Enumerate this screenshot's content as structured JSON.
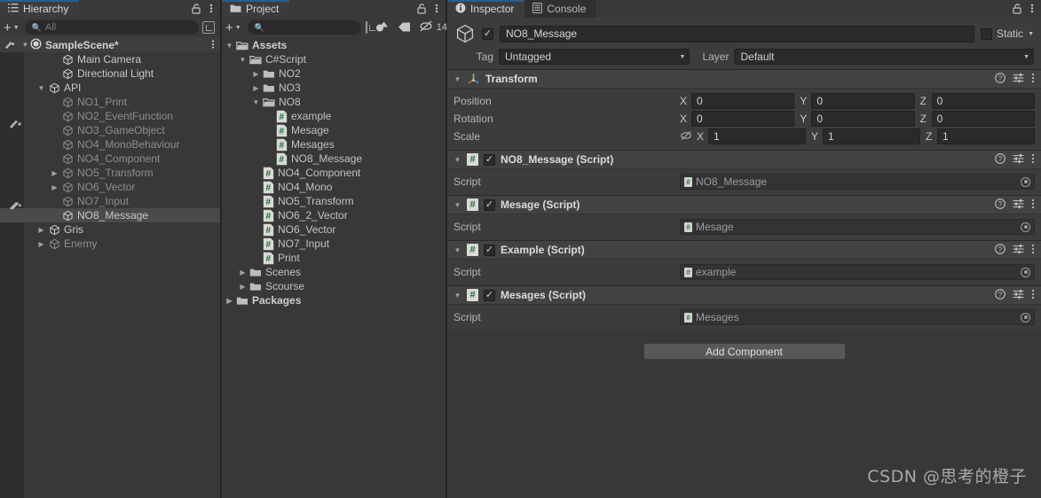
{
  "hierarchy": {
    "tab_label": "Hierarchy",
    "tab_icon": "list-icon",
    "lock_icon": "lock-open-icon",
    "menu_icon": "kebab-menu-icon",
    "add_label": "+",
    "search_placeholder": "All",
    "search_value": "",
    "scene_name": "SampleScene*",
    "items": [
      {
        "label": "Main Camera",
        "depth": 2,
        "arrow": "none",
        "dim": false
      },
      {
        "label": "Directional Light",
        "depth": 2,
        "arrow": "none",
        "dim": false
      },
      {
        "label": "API",
        "depth": 1,
        "arrow": "open",
        "dim": false
      },
      {
        "label": "NO1_Print",
        "depth": 2,
        "arrow": "none",
        "dim": true
      },
      {
        "label": "NO2_EventFunction",
        "depth": 2,
        "arrow": "none",
        "dim": true
      },
      {
        "label": "NO3_GameObject",
        "depth": 2,
        "arrow": "none",
        "dim": true
      },
      {
        "label": "NO4_MonoBehaviour",
        "depth": 2,
        "arrow": "none",
        "dim": true
      },
      {
        "label": "NO4_Component",
        "depth": 2,
        "arrow": "none",
        "dim": true
      },
      {
        "label": "NO5_Transform",
        "depth": 2,
        "arrow": "closed",
        "dim": true
      },
      {
        "label": "NO6_Vector",
        "depth": 2,
        "arrow": "closed",
        "dim": true
      },
      {
        "label": "NO7_Input",
        "depth": 2,
        "arrow": "none",
        "dim": true
      },
      {
        "label": "NO8_Message",
        "depth": 2,
        "arrow": "none",
        "dim": false,
        "selected": true
      },
      {
        "label": "Gris",
        "depth": 1,
        "arrow": "closed",
        "dim": false
      },
      {
        "label": "Enemy",
        "depth": 1,
        "arrow": "closed",
        "dim": true
      }
    ]
  },
  "project": {
    "tab_label": "Project",
    "tab_icon": "folder-icon",
    "lock_icon": "lock-open-icon",
    "menu_icon": "kebab-menu-icon",
    "add_label": "+",
    "search_placeholder": "",
    "search_value": "",
    "hidden_count": "14",
    "items": [
      {
        "label": "Assets",
        "depth": 0,
        "arrow": "open",
        "type": "folder-open",
        "bold": true
      },
      {
        "label": "C#Script",
        "depth": 1,
        "arrow": "open",
        "type": "folder-open",
        "bold": false
      },
      {
        "label": "NO2",
        "depth": 2,
        "arrow": "closed",
        "type": "folder",
        "bold": false
      },
      {
        "label": "NO3",
        "depth": 2,
        "arrow": "closed",
        "type": "folder",
        "bold": false
      },
      {
        "label": "NO8",
        "depth": 2,
        "arrow": "open",
        "type": "folder-open",
        "bold": false
      },
      {
        "label": "example",
        "depth": 3,
        "arrow": "none",
        "type": "cs",
        "bold": false
      },
      {
        "label": "Mesage",
        "depth": 3,
        "arrow": "none",
        "type": "cs",
        "bold": false
      },
      {
        "label": "Mesages",
        "depth": 3,
        "arrow": "none",
        "type": "cs",
        "bold": false
      },
      {
        "label": "NO8_Message",
        "depth": 3,
        "arrow": "none",
        "type": "cs",
        "bold": false
      },
      {
        "label": "NO4_Component",
        "depth": 2,
        "arrow": "none",
        "type": "cs",
        "bold": false
      },
      {
        "label": "NO4_Mono",
        "depth": 2,
        "arrow": "none",
        "type": "cs",
        "bold": false
      },
      {
        "label": "NO5_Transform",
        "depth": 2,
        "arrow": "none",
        "type": "cs",
        "bold": false
      },
      {
        "label": "NO6_2_Vector",
        "depth": 2,
        "arrow": "none",
        "type": "cs",
        "bold": false
      },
      {
        "label": "NO6_Vector",
        "depth": 2,
        "arrow": "none",
        "type": "cs",
        "bold": false
      },
      {
        "label": "NO7_Input",
        "depth": 2,
        "arrow": "none",
        "type": "cs",
        "bold": false
      },
      {
        "label": "Print",
        "depth": 2,
        "arrow": "none",
        "type": "cs",
        "bold": false
      },
      {
        "label": "Scenes",
        "depth": 1,
        "arrow": "closed",
        "type": "folder",
        "bold": false
      },
      {
        "label": "Scourse",
        "depth": 1,
        "arrow": "closed",
        "type": "folder",
        "bold": false
      },
      {
        "label": "Packages",
        "depth": 0,
        "arrow": "closed",
        "type": "folder",
        "bold": true
      }
    ]
  },
  "inspector": {
    "tabs": [
      {
        "label": "Inspector",
        "icon": "info-icon",
        "active": true
      },
      {
        "label": "Console",
        "icon": "console-icon",
        "active": false
      }
    ],
    "lock_icon": "lock-open-icon",
    "menu_icon": "kebab-menu-icon",
    "gameobject": {
      "enabled_check": "✓",
      "name": "NO8_Message",
      "static_label": "Static",
      "tag_label": "Tag",
      "tag_value": "Untagged",
      "layer_label": "Layer",
      "layer_value": "Default"
    },
    "transform": {
      "title": "Transform",
      "icon": "transform-axis-icon",
      "rows": [
        {
          "name": "Position",
          "x": "0",
          "y": "0",
          "z": "0",
          "lock": false
        },
        {
          "name": "Rotation",
          "x": "0",
          "y": "0",
          "z": "0",
          "lock": false
        },
        {
          "name": "Scale",
          "x": "1",
          "y": "1",
          "z": "1",
          "lock": true
        }
      ],
      "axis_x": "X",
      "axis_y": "Y",
      "axis_z": "Z"
    },
    "script_prop_label": "Script",
    "components": [
      {
        "title": "NO8_Message (Script)",
        "script_value": "NO8_Message",
        "checked": "✓"
      },
      {
        "title": "Mesage (Script)",
        "script_value": "Mesage",
        "checked": "✓"
      },
      {
        "title": "Example (Script)",
        "script_value": "example",
        "checked": "✓"
      },
      {
        "title": "Mesages (Script)",
        "script_value": "Mesages",
        "checked": "✓"
      }
    ],
    "add_component_label": "Add Component",
    "header_icons": {
      "help": "help-icon",
      "preset": "preset-settings-icon",
      "menu": "kebab-menu-icon"
    }
  },
  "watermark": "CSDN @思考的橙子",
  "colors": {
    "panel_bg": "#383838",
    "toolbar_bg": "#393939",
    "tab_active_accent": "#2c5d87",
    "selection": "#4a4a4a",
    "component_header": "#424242",
    "field_bg": "#2a2a2a"
  }
}
